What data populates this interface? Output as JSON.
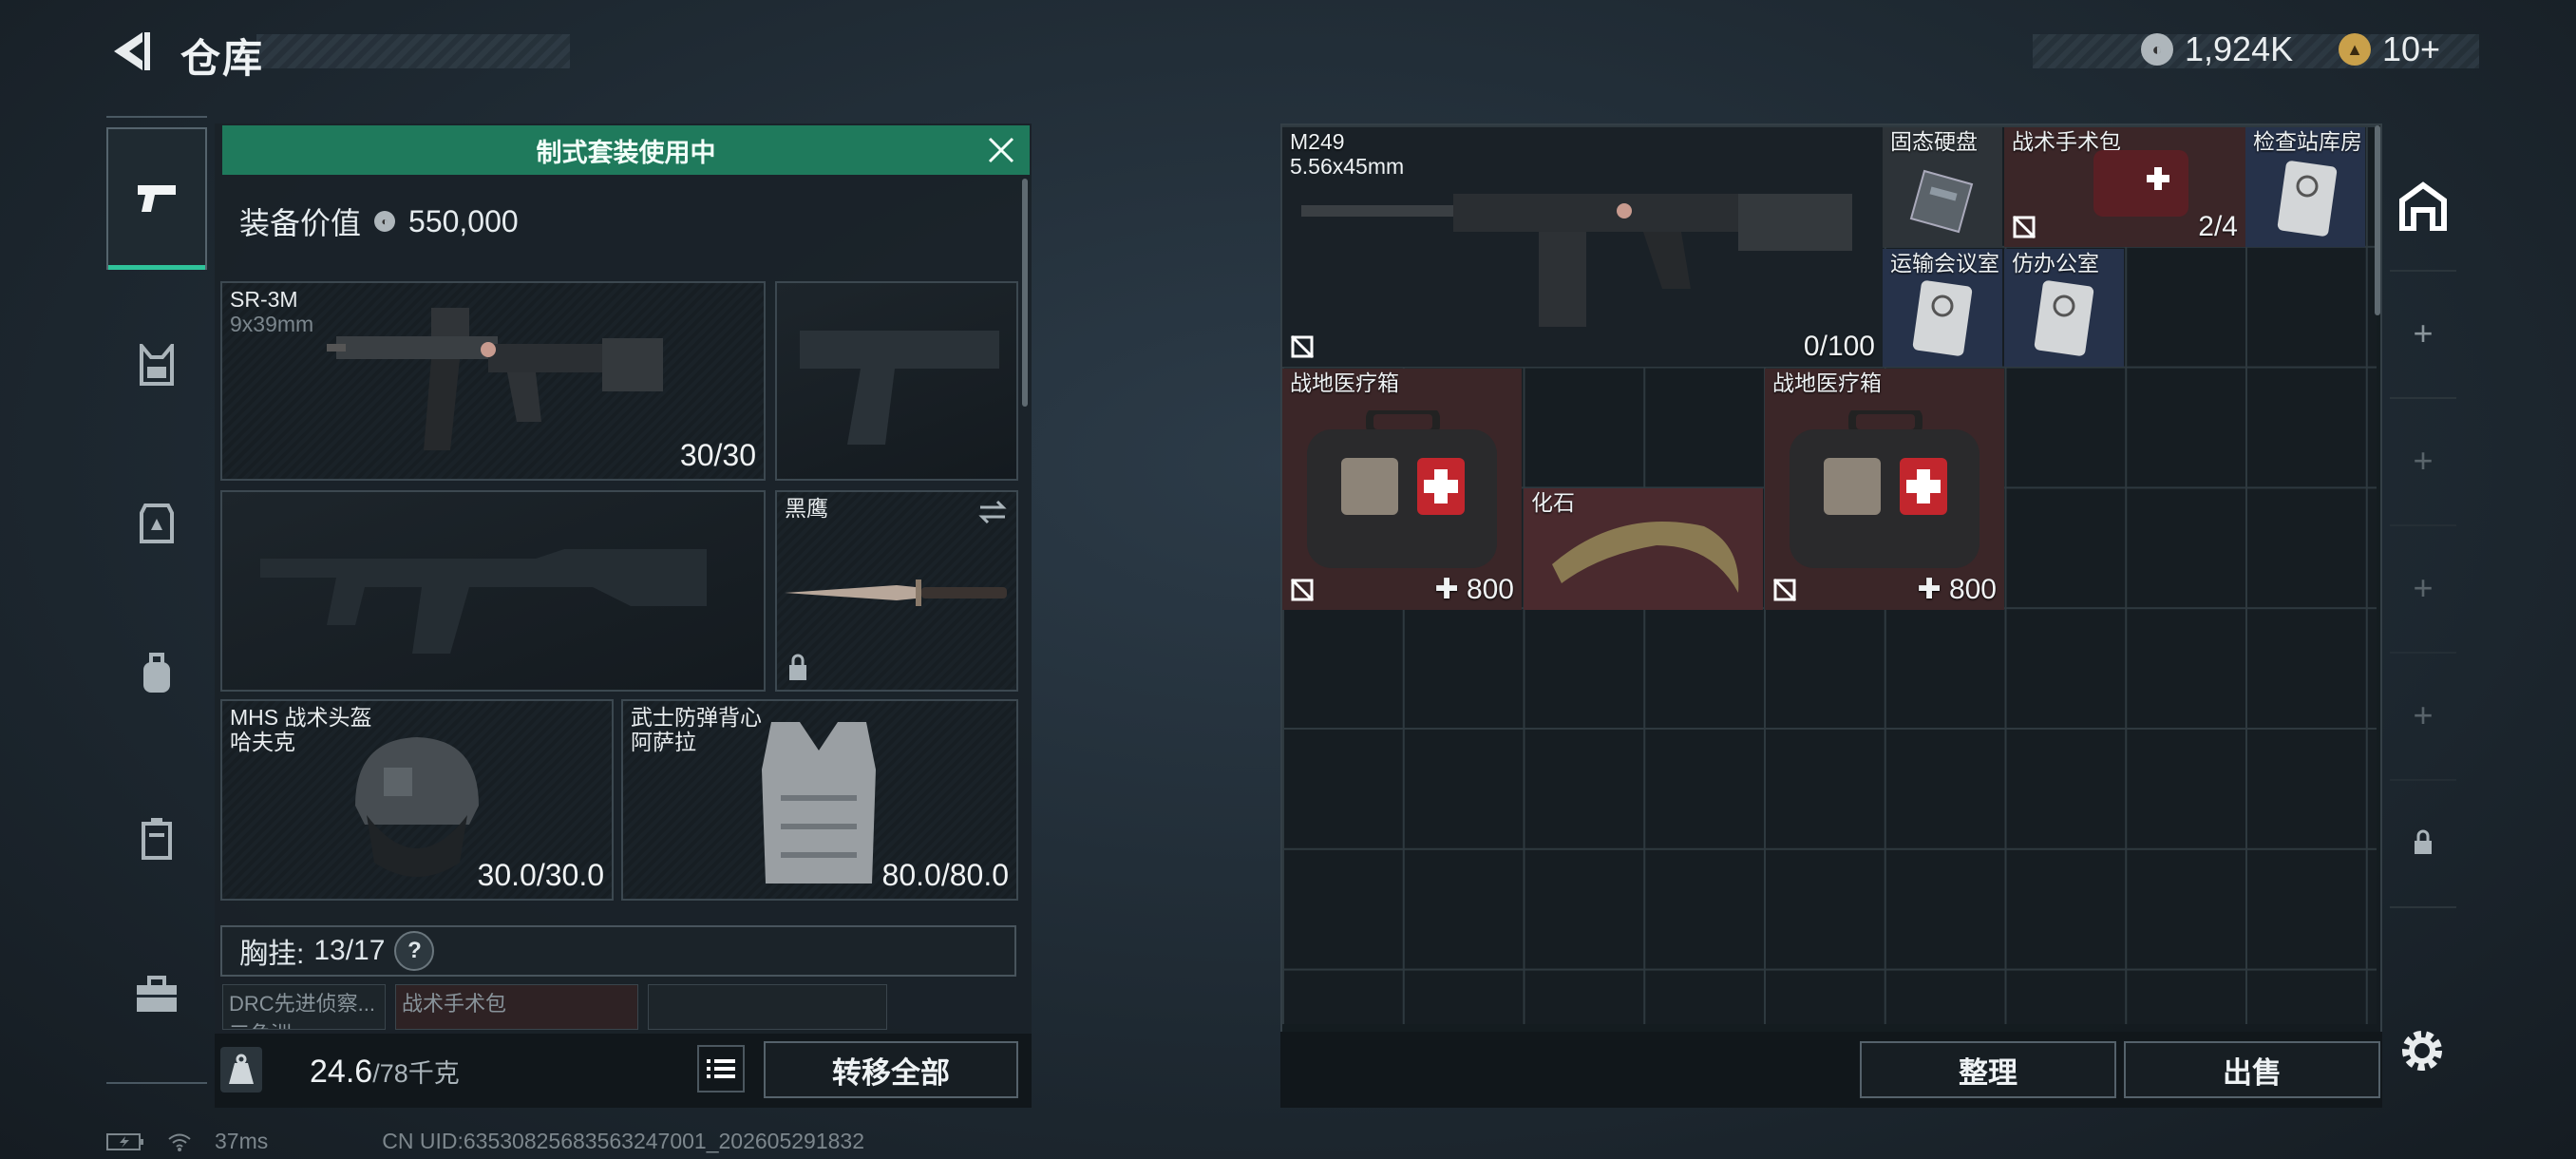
{
  "header": {
    "title": "仓库"
  },
  "currency": {
    "coins_value": "1,924K",
    "tokens_value": "10+"
  },
  "rail": {
    "items": [
      "weapons-icon",
      "tactical-vest-icon",
      "body-armor-icon",
      "backpack-icon",
      "container-icon",
      "briefcase-icon"
    ]
  },
  "loadout": {
    "banner": "制式套装使用中",
    "value_label": "装备价值",
    "value": "550,000",
    "primary": {
      "name": "SR-3M",
      "caliber": "9x39mm",
      "ammo": "30/30"
    },
    "melee": {
      "name": "黑鹰"
    },
    "helmet": {
      "name": "MHS 战术头盔",
      "sub": "哈夫克",
      "durability": "30.0/30.0"
    },
    "armor": {
      "name": "武士防弹背心",
      "sub": "阿萨拉",
      "durability": "80.0/80.0"
    },
    "chest": {
      "label": "胸挂:",
      "capacity": "13/17",
      "help": "?"
    },
    "chest_items": [
      "DRC先进侦察...",
      "战术手术包",
      "三角洲",
      ""
    ],
    "weight": {
      "value": "24.6",
      "limit": "/78千克"
    },
    "transfer_all": "转移全部"
  },
  "storage": {
    "items": {
      "m249": {
        "name": "M249",
        "caliber": "5.56x45mm",
        "ammo": "0/100"
      },
      "ssd": {
        "name": "固态硬盘"
      },
      "surgical_kit": {
        "name": "战术手术包",
        "count": "2/4"
      },
      "checkpoint_key": {
        "name": "检查站库房"
      },
      "transport_key": {
        "name": "运输会议室"
      },
      "office_key": {
        "name": "仿办公室"
      },
      "medkit1": {
        "name": "战地医疗箱",
        "count": "800"
      },
      "fossil": {
        "name": "化石"
      },
      "medkit2": {
        "name": "战地医疗箱",
        "count": "800"
      }
    },
    "sort_button": "整理",
    "sell_button": "出售"
  },
  "status": {
    "ping": "37ms",
    "uid": "CN UID:63530825683563247001_202605291832"
  }
}
